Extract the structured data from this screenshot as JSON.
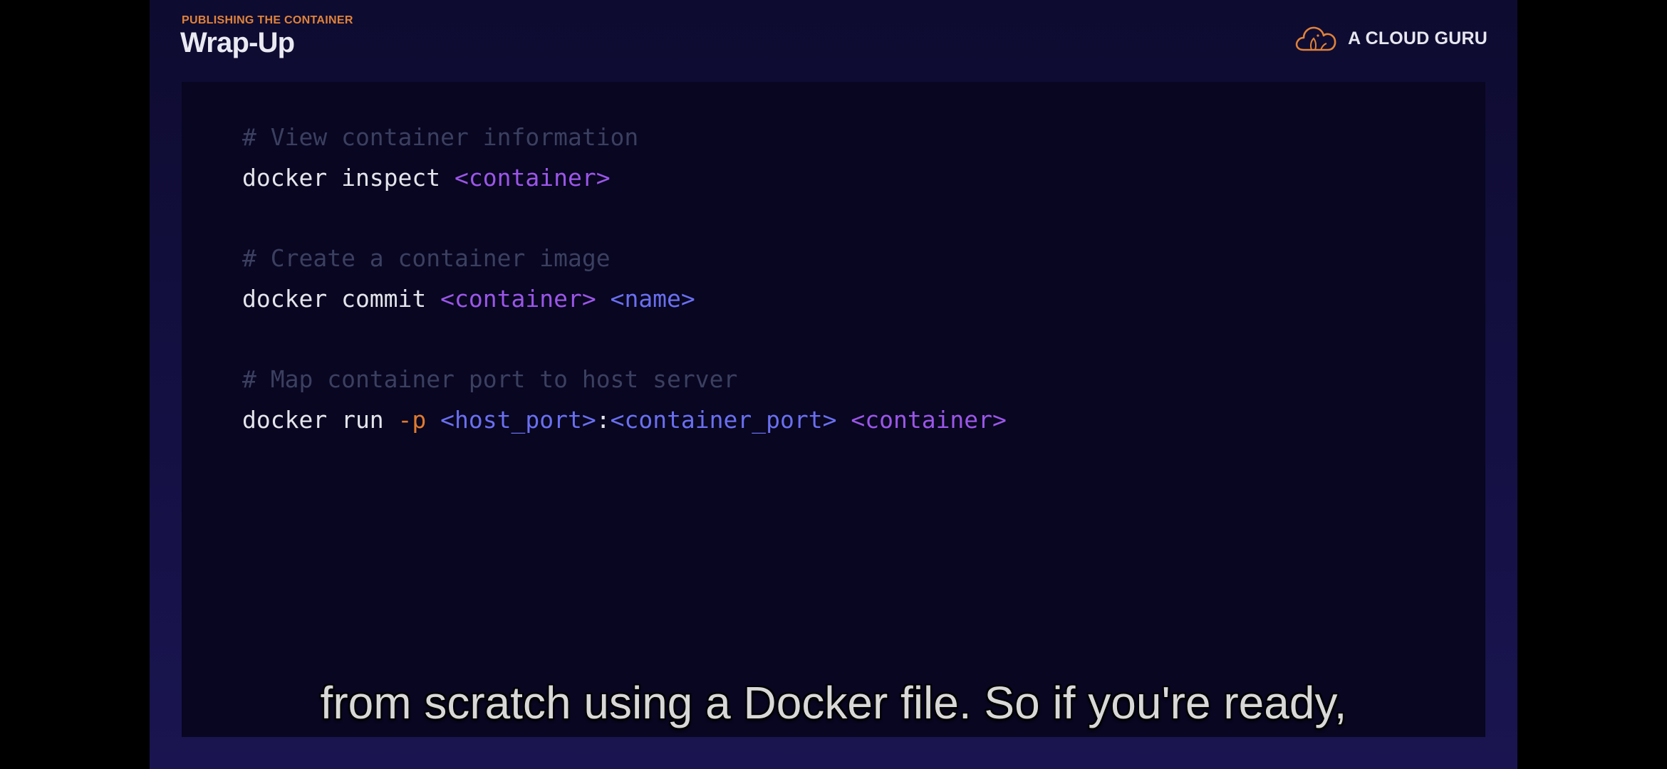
{
  "header": {
    "eyebrow": "PUBLISHING THE CONTAINER",
    "title": "Wrap-Up"
  },
  "brand": {
    "name": "A CLOUD GURU",
    "logo_icon": "cloud-guru-logo-icon"
  },
  "code": {
    "blocks": [
      {
        "comment": "# View container information",
        "command_parts": [
          {
            "text": "docker inspect ",
            "style": "cmd"
          },
          {
            "text": "<container>",
            "style": "ph-purple"
          }
        ]
      },
      {
        "comment": "# Create a container image",
        "command_parts": [
          {
            "text": "docker commit ",
            "style": "cmd"
          },
          {
            "text": "<container>",
            "style": "ph-purple"
          },
          {
            "text": " ",
            "style": "cmd"
          },
          {
            "text": "<name>",
            "style": "ph-blue"
          }
        ]
      },
      {
        "comment": "# Map container port to host server",
        "command_parts": [
          {
            "text": "docker run ",
            "style": "cmd"
          },
          {
            "text": "-p",
            "style": "flag"
          },
          {
            "text": " ",
            "style": "cmd"
          },
          {
            "text": "<host_port>",
            "style": "ph-blue"
          },
          {
            "text": ":",
            "style": "cmd"
          },
          {
            "text": "<container_port>",
            "style": "ph-blue"
          },
          {
            "text": " ",
            "style": "cmd"
          },
          {
            "text": "<container>",
            "style": "ph-purple"
          }
        ]
      }
    ]
  },
  "caption": "from scratch using a Docker file. So if you're ready,",
  "colors": {
    "accent_orange": "#e0833a",
    "placeholder_purple": "#9b56e8",
    "placeholder_blue": "#6a6ff0",
    "comment": "#3b3f60",
    "command": "#e4e4ec",
    "slide_background": "#141043",
    "code_background": "#080620"
  }
}
